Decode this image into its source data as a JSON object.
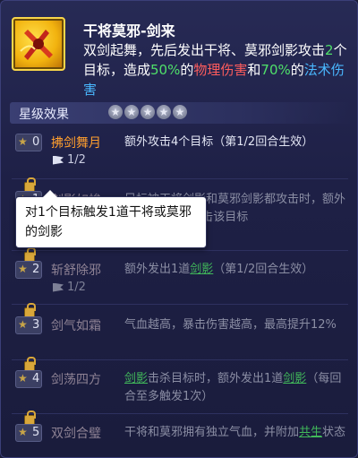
{
  "skill": {
    "icon": "dual-sword-icon",
    "name": "干将莫邪-剑来",
    "desc_1": "双剑起舞，先后发出干将、莫邪剑影攻击",
    "desc_num": "2",
    "desc_2": "个目标，造成",
    "desc_pct1": "50%",
    "desc_3": "的",
    "desc_phys": "物理伤害",
    "desc_4": "和",
    "desc_pct2": "70%",
    "desc_5": "的",
    "desc_magic": "法术伤害"
  },
  "star_section": {
    "title": "星级效果",
    "pips": [
      "★",
      "★",
      "★",
      "★",
      "★"
    ]
  },
  "rows": [
    {
      "level": "0",
      "name": "拂剑舞月",
      "progress": "1/2",
      "desc": "额外攻击4个目标（第1/2回合生效）"
    },
    {
      "level": "1",
      "name": "剑影如梭",
      "desc_a": "目标被干将剑影和莫邪剑影都攻击时，额外发出1道",
      "desc_link": "剑影",
      "desc_b": "攻击该目标"
    },
    {
      "level": "2",
      "name": "斩舒除邪",
      "progress": "1/2",
      "desc_a": "额外发出1道",
      "desc_link": "剑影",
      "desc_b": "（第1/2回合生效）"
    },
    {
      "level": "3",
      "name": "剑气如霜",
      "desc": "气血越高，暴击伤害越高，最高提升12%"
    },
    {
      "level": "4",
      "name": "剑荡四方",
      "desc_link1": "剑影",
      "desc_a": "击杀目标时，额外发出1道",
      "desc_link2": "剑影",
      "desc_b": "（每回合至多触发1次）"
    },
    {
      "level": "5",
      "name": "双剑合璧",
      "desc_a": "干将和莫邪拥有独立气血，并附加",
      "desc_link": "共生",
      "desc_b": "状态"
    }
  ],
  "tooltip": {
    "text": "对1个目标触发1道干将或莫邪的剑影"
  },
  "colors": {
    "name_active": "#ff9f2e",
    "name_locked": "#8e8294",
    "link": "#41b85a",
    "green": "#4fe06a",
    "red": "#ff5d5d",
    "blue": "#4ab8ff"
  }
}
